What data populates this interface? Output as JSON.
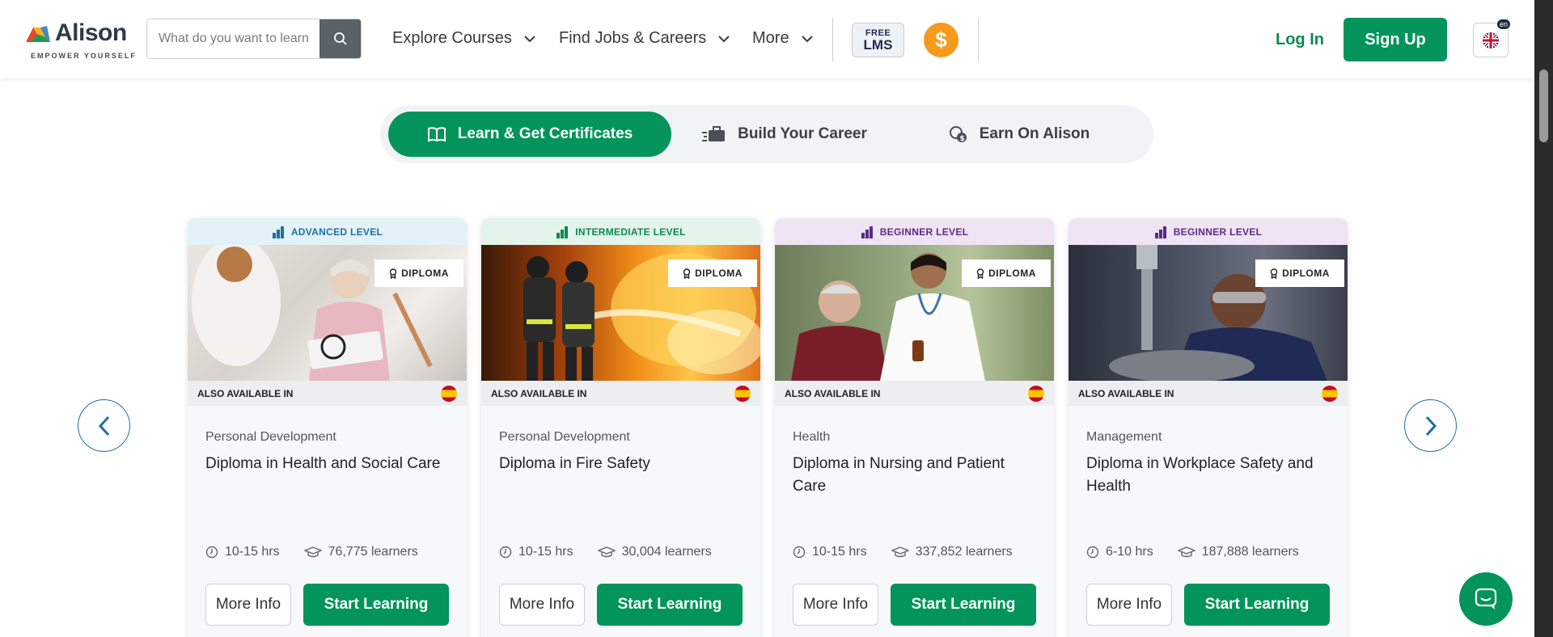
{
  "header": {
    "logo_text": "Alison",
    "logo_tagline": "EMPOWER YOURSELF",
    "search_placeholder": "What do you want to learn?",
    "nav": [
      {
        "label": "Explore Courses"
      },
      {
        "label": "Find Jobs & Careers"
      },
      {
        "label": "More"
      }
    ],
    "free_lms_top": "FREE",
    "free_lms_bottom": "LMS",
    "coin_symbol": "$",
    "login_label": "Log In",
    "signup_label": "Sign Up",
    "language_code": "en"
  },
  "tabs": [
    {
      "label": "Learn & Get Certificates",
      "icon": "book-icon",
      "active": true
    },
    {
      "label": "Build Your Career",
      "icon": "career-icon",
      "active": false
    },
    {
      "label": "Earn On Alison",
      "icon": "earn-icon",
      "active": false
    }
  ],
  "cards": [
    {
      "level": "ADVANCED LEVEL",
      "badge": "DIPLOMA",
      "also_available": "ALSO AVAILABLE IN",
      "category": "Personal Development",
      "title": "Diploma in Health and Social Care",
      "duration": "10-15 hrs",
      "learners": "76,775 learners",
      "more_info": "More Info",
      "start": "Start Learning"
    },
    {
      "level": "INTERMEDIATE LEVEL",
      "badge": "DIPLOMA",
      "also_available": "ALSO AVAILABLE IN",
      "category": "Personal Development",
      "title": "Diploma in Fire Safety",
      "duration": "10-15 hrs",
      "learners": "30,004 learners",
      "more_info": "More Info",
      "start": "Start Learning"
    },
    {
      "level": "BEGINNER LEVEL",
      "badge": "DIPLOMA",
      "also_available": "ALSO AVAILABLE IN",
      "category": "Health",
      "title": "Diploma in Nursing and Patient Care",
      "duration": "10-15 hrs",
      "learners": "337,852 learners",
      "more_info": "More Info",
      "start": "Start Learning"
    },
    {
      "level": "BEGINNER LEVEL",
      "badge": "DIPLOMA",
      "also_available": "ALSO AVAILABLE IN",
      "category": "Management",
      "title": "Diploma in Workplace Safety and Health",
      "duration": "6-10 hrs",
      "learners": "187,888 learners",
      "more_info": "More Info",
      "start": "Start Learning"
    }
  ],
  "colors": {
    "brand_green": "#02945a",
    "advanced": "#1f6f9e",
    "intermediate": "#0a8a4e",
    "beginner": "#5b2a86"
  }
}
